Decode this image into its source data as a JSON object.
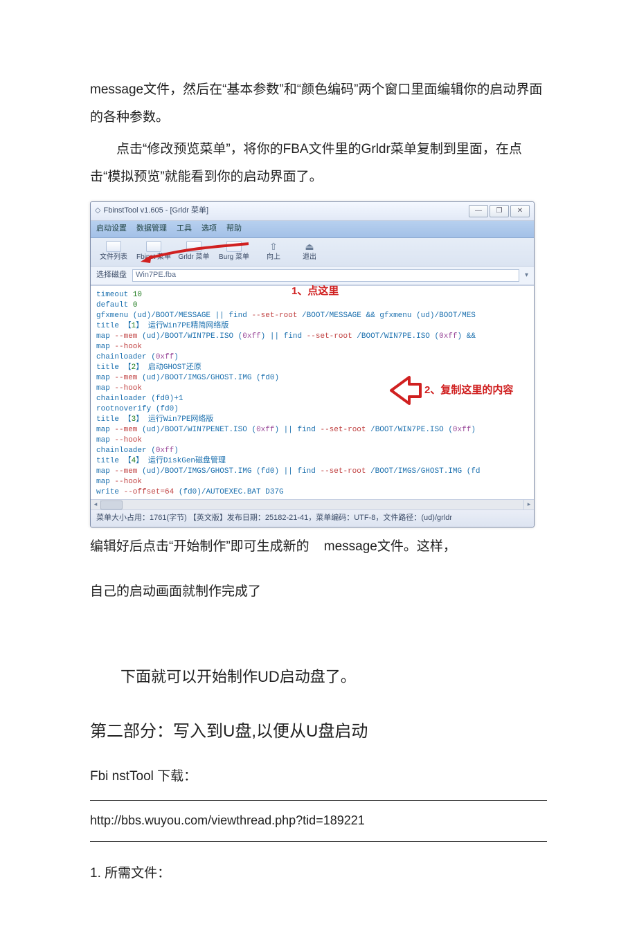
{
  "doc": {
    "p1": "message文件，然后在“基本参数”和“颜色编码”两个窗口里面编辑你的启动界面的各种参数。",
    "p2": "点击“修改预览菜单”，将你的FBA文件里的Grldr菜单复制到里面，在点击“模拟预览”就能看到你的启动界面了。",
    "p3a": "编辑好后点击“开始制作”即可生成新的",
    "p3b": "message文件。这样，",
    "p4": "自己的启动画面就制作完成了",
    "sectionTitle": "下面就可以开始制作UD启动盘了。",
    "partTitle": "第二部分：写入到U盘,以便从U盘启动",
    "downloadLabel": "Fbi nstTool 下载：",
    "link": "http://bbs.wuyou.com/viewthread.php?tid=189221",
    "item1": "1.   所需文件："
  },
  "window": {
    "title": "FbinstTool v1.605 - [Grldr 菜单]",
    "menus": [
      "启动设置",
      "数据管理",
      "工具",
      "选项",
      "帮助"
    ],
    "toolbar": [
      "文件列表",
      "Fbinst 菜单",
      "Grldr 菜单",
      "Burg 菜单",
      "向上",
      "退出"
    ],
    "diskLabel": "选择磁盘",
    "diskValue": "Win7PE.fba",
    "note1": "1、点这里",
    "note2": "2、复制这里的内容",
    "status": "菜单大小占用：1761(字节)   【英文版】发布日期：25182-21-41，菜单编码：UTF-8，文件路径：(ud)/grldr",
    "code": {
      "l1a": "timeout",
      "l1b": " 10",
      "l2a": "default",
      "l2b": " 0",
      "l3a": "gfxmenu (ud)/BOOT/MESSAGE || find ",
      "l3b": "--set-root",
      "l3c": " /BOOT/MESSAGE && gfxmenu (ud)/BOOT/MES",
      "l4a": "title 【",
      "l4b": "1",
      "l4c": "】 运行Win7PE精简网络版",
      "l5a": "map ",
      "l5b": "--mem",
      "l5c": " (ud)/BOOT/WIN7PE.ISO (",
      "l5d": "0xff",
      "l5e": ") || find ",
      "l5f": "--set-root",
      "l5g": " /BOOT/WIN7PE.ISO (",
      "l5h": "0xff",
      "l5i": ") &&",
      "l6a": "map ",
      "l6b": "--hook",
      "l7a": "chainloader (",
      "l7b": "0xff",
      "l7c": ")",
      "l8a": "title 【",
      "l8b": "2",
      "l8c": "】 启动GHOST还原",
      "l9a": "map ",
      "l9b": "--mem",
      "l9c": " (ud)/BOOT/IMGS/GHOST.IMG (fd0)",
      "l10a": "map ",
      "l10b": "--hook",
      "l11": "chainloader (fd0)+1",
      "l12": "rootnoverify (fd0)",
      "l13a": "title 【",
      "l13b": "3",
      "l13c": "】 运行Win7PE网络版",
      "l14a": "map ",
      "l14b": "--mem",
      "l14c": " (ud)/BOOT/WIN7PENET.ISO (",
      "l14d": "0xff",
      "l14e": ") || find ",
      "l14f": "--set-root",
      "l14g": " /BOOT/WIN7PE.ISO (",
      "l14h": "0xff",
      "l14i": ")",
      "l15a": "map ",
      "l15b": "--hook",
      "l16a": "chainloader (",
      "l16b": "0xff",
      "l16c": ")",
      "l17a": "title 【",
      "l17b": "4",
      "l17c": "】 运行DiskGen磁盘管理",
      "l18a": "map ",
      "l18b": "--mem",
      "l18c": " (ud)/BOOT/IMGS/GHOST.IMG (fd0) || find ",
      "l18d": "--set-root",
      "l18e": " /BOOT/IMGS/GHOST.IMG (fd",
      "l19a": "map ",
      "l19b": "--hook",
      "l20a": "write ",
      "l20b": "--offset=64",
      "l20c": " (fd0)/AUTOEXEC.BAT D37G"
    }
  }
}
